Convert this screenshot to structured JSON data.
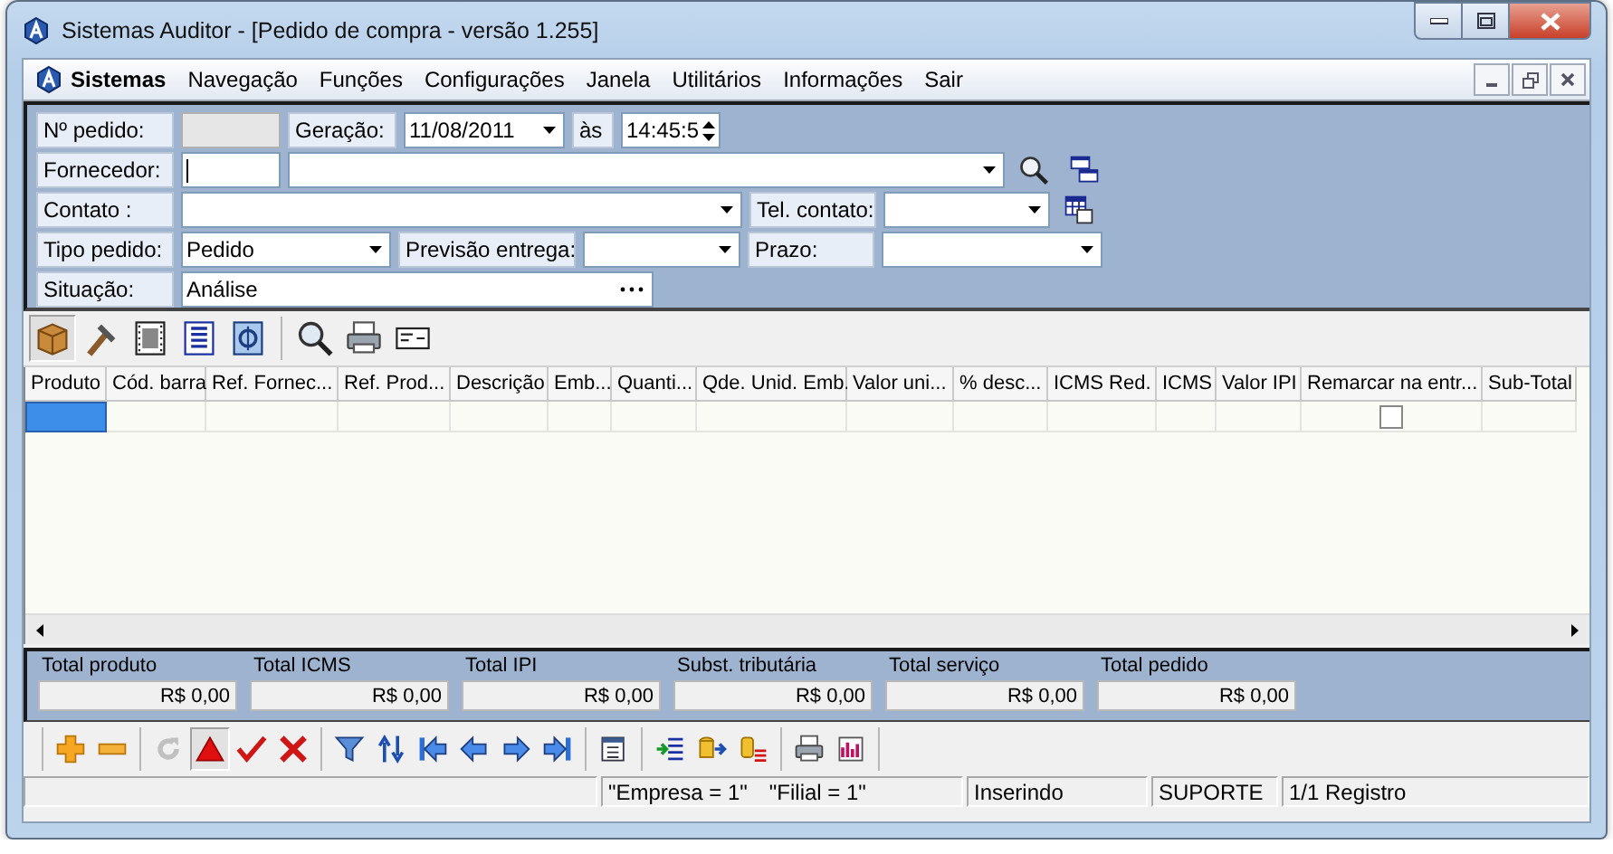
{
  "window": {
    "title": "Sistemas Auditor - [Pedido de compra - versão 1.255]"
  },
  "menu": [
    {
      "label": "Sistemas",
      "kind": "app"
    },
    {
      "label": "Navegação",
      "kind": "item"
    },
    {
      "label": "Funções",
      "kind": "item"
    },
    {
      "label": "Configurações",
      "kind": "item"
    },
    {
      "label": "Janela",
      "kind": "item"
    },
    {
      "label": "Utilitários",
      "kind": "item"
    },
    {
      "label": "Informações",
      "kind": "item"
    },
    {
      "label": "Sair",
      "kind": "item"
    }
  ],
  "form": {
    "lines": [
      {
        "fields": [
          {
            "kind": "label",
            "text": "Nº pedido:"
          },
          {
            "kind": "input",
            "disabled": true
          },
          {
            "kind": "label",
            "text": "Geração:"
          },
          {
            "kind": "combo",
            "value": "11/08/2011"
          },
          {
            "kind": "label",
            "text": "às"
          },
          {
            "kind": "spin",
            "value": "14:45:5"
          }
        ]
      },
      {
        "fields": [
          {
            "kind": "label",
            "text": "Fornecedor:"
          },
          {
            "kind": "input",
            "disabled": false,
            "focused": true
          },
          {
            "kind": "combo"
          },
          {
            "kind": "search"
          },
          {
            "kind": "windows"
          }
        ]
      },
      {
        "fields": [
          {
            "kind": "label",
            "text": "Contato :"
          },
          {
            "kind": "combo"
          },
          {
            "kind": "label",
            "text": "Tel. contato:"
          },
          {
            "kind": "combo"
          },
          {
            "kind": "grid"
          }
        ]
      },
      {
        "fields": [
          {
            "kind": "label",
            "text": "Tipo pedido:"
          },
          {
            "kind": "combo",
            "value": "Pedido"
          },
          {
            "kind": "label",
            "text": "Previsão entrega:"
          },
          {
            "kind": "combo"
          },
          {
            "kind": "label",
            "text": "Prazo:"
          },
          {
            "kind": "combo"
          }
        ]
      },
      {
        "fields": [
          {
            "kind": "label",
            "text": "Situação:"
          },
          {
            "kind": "lookup",
            "value": "Análise"
          }
        ]
      }
    ]
  },
  "toolbar": [
    {
      "kind": "box",
      "pressed": true
    },
    {
      "kind": "hammer",
      "pressed": false
    },
    {
      "kind": "film",
      "pressed": false
    },
    {
      "kind": "document",
      "pressed": false
    },
    {
      "kind": "invoice",
      "pressed": false
    },
    {
      "kind": "magnifier",
      "pressed": false
    },
    {
      "kind": "printer",
      "pressed": false
    },
    {
      "kind": "card",
      "pressed": false
    }
  ],
  "table": {
    "columns": [
      "Produto",
      "Cód. barra",
      "Ref. Fornec...",
      "Ref. Prod...",
      "Descrição",
      "Emb...",
      "Quanti...",
      "Qde. Unid. Emb.",
      "Valor uni...",
      "% desc...",
      "ICMS Red.",
      "ICMS",
      "Valor IPI",
      "Remarcar na entr...",
      "Sub-Total"
    ],
    "rows": [
      {
        "cells": [
          {
            "selected": true
          },
          {
            "selected": false
          },
          {
            "selected": false
          },
          {
            "selected": false
          },
          {
            "selected": false
          },
          {
            "selected": false
          },
          {
            "selected": false
          },
          {
            "selected": false
          },
          {
            "selected": false
          },
          {
            "selected": false
          },
          {
            "selected": false
          },
          {
            "selected": false
          },
          {
            "selected": false
          },
          {
            "selected": false,
            "kind": "checkbox",
            "checked": false
          },
          {
            "selected": false
          }
        ]
      }
    ]
  },
  "totals": [
    {
      "label": "Total produto",
      "value": "R$ 0,00"
    },
    {
      "label": "Total ICMS",
      "value": "R$ 0,00"
    },
    {
      "label": "Total IPI",
      "value": "R$ 0,00"
    },
    {
      "label": "Subst. tributária",
      "value": "R$ 0,00"
    },
    {
      "label": "Total serviço",
      "value": "R$ 0,00"
    },
    {
      "label": "Total pedido",
      "value": "R$ 0,00"
    }
  ],
  "bottom_toolbar": [
    {
      "buttons": [
        {
          "kind": "plus",
          "pressed": false,
          "disabled": false
        },
        {
          "kind": "minus",
          "pressed": false,
          "disabled": false
        }
      ]
    },
    {
      "buttons": [
        {
          "kind": "refresh",
          "pressed": false,
          "disabled": true
        },
        {
          "kind": "triangle",
          "pressed": true,
          "disabled": false
        },
        {
          "kind": "check",
          "pressed": false,
          "disabled": false
        },
        {
          "kind": "cross",
          "pressed": false,
          "disabled": false
        }
      ]
    },
    {
      "buttons": [
        {
          "kind": "funnel",
          "pressed": false,
          "disabled": false
        },
        {
          "kind": "swap",
          "pressed": false,
          "disabled": false
        },
        {
          "kind": "first",
          "pressed": false,
          "disabled": false
        },
        {
          "kind": "previous",
          "pressed": false,
          "disabled": false
        },
        {
          "kind": "next",
          "pressed": false,
          "disabled": false
        },
        {
          "kind": "last",
          "pressed": false,
          "disabled": false
        }
      ]
    },
    {
      "buttons": [
        {
          "kind": "window",
          "pressed": false,
          "disabled": false
        }
      ]
    },
    {
      "buttons": [
        {
          "kind": "import",
          "pressed": false,
          "disabled": false
        },
        {
          "kind": "transfer",
          "pressed": false,
          "disabled": false
        },
        {
          "kind": "list",
          "pressed": false,
          "disabled": false
        }
      ]
    },
    {
      "buttons": [
        {
          "kind": "printer",
          "pressed": false,
          "disabled": false
        },
        {
          "kind": "chart",
          "pressed": false,
          "disabled": false
        }
      ]
    }
  ],
  "status_bar": [
    {
      "texts": [
        "\"Empresa = 1\"",
        "\"Filial = 1\""
      ]
    },
    {
      "texts": [
        "Inserindo"
      ]
    },
    {
      "texts": [
        "SUPORTE"
      ]
    },
    {
      "texts": [
        "1/1 Registro"
      ]
    }
  ]
}
